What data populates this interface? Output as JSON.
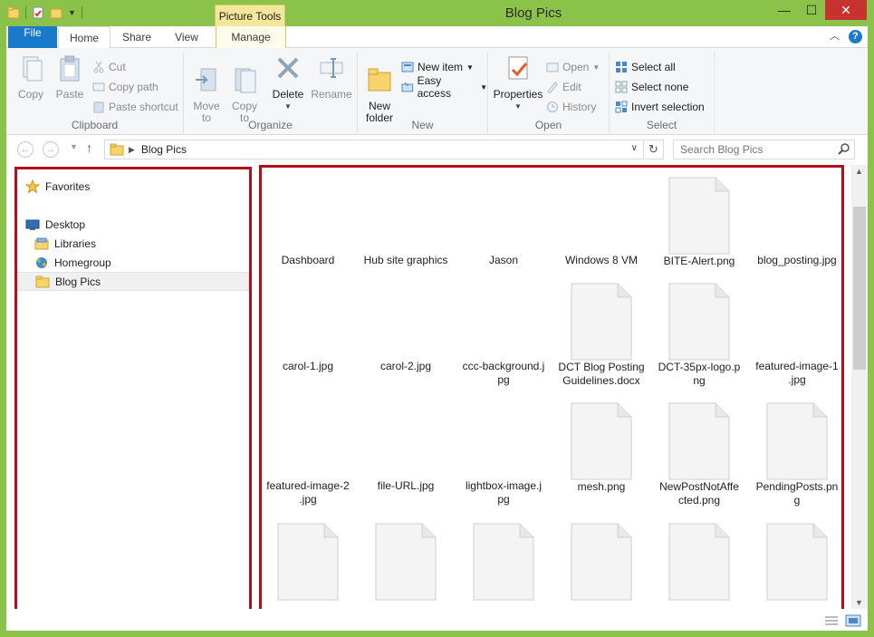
{
  "window": {
    "title": "Blog Pics",
    "context_tab_group": "Picture Tools",
    "controls": {
      "minimize": "—",
      "maximize": "☐",
      "close": "✕"
    }
  },
  "tabs": {
    "file": "File",
    "home": "Home",
    "share": "Share",
    "view": "View",
    "manage": "Manage",
    "help": "?"
  },
  "ribbon": {
    "clipboard": {
      "label": "Clipboard",
      "copy": "Copy",
      "paste": "Paste",
      "cut": "Cut",
      "copy_path": "Copy path",
      "paste_shortcut": "Paste shortcut"
    },
    "organize": {
      "label": "Organize",
      "move_to": "Move\nto",
      "copy_to": "Copy\nto",
      "delete": "Delete",
      "rename": "Rename"
    },
    "new": {
      "label": "New",
      "new_folder": "New\nfolder",
      "new_item": "New item",
      "easy_access": "Easy access"
    },
    "open": {
      "label": "Open",
      "properties": "Properties",
      "open": "Open",
      "edit": "Edit",
      "history": "History"
    },
    "select": {
      "label": "Select",
      "select_all": "Select all",
      "select_none": "Select none",
      "invert_selection": "Invert selection"
    }
  },
  "address": {
    "path": "Blog Pics",
    "search_placeholder": "Search Blog Pics"
  },
  "nav": {
    "favorites": "Favorites",
    "desktop": "Desktop",
    "libraries": "Libraries",
    "homegroup": "Homegroup",
    "blog_pics": "Blog Pics"
  },
  "files": {
    "row1": [
      "Dashboard",
      "Hub site graphics",
      "Jason",
      "Windows 8 VM",
      "BITE-Alert.png",
      "blog_posting.jpg"
    ],
    "row2": [
      [
        "carol-1.jpg",
        ""
      ],
      [
        "carol-2.jpg",
        ""
      ],
      [
        "ccc-background.j",
        "pg"
      ],
      [
        "DCT Blog Posting",
        "Guidelines.docx"
      ],
      [
        "DCT-35px-logo.p",
        "ng"
      ],
      [
        "featured-image-1",
        ".jpg"
      ]
    ],
    "row3": [
      [
        "featured-image-2",
        ".jpg"
      ],
      [
        "file-URL.jpg",
        ""
      ],
      [
        "lightbox-image.j",
        "pg"
      ],
      [
        "mesh.png",
        ""
      ],
      [
        "NewPostNotAffe",
        "cted.png"
      ],
      [
        "PendingPosts.pn",
        "g"
      ]
    ]
  },
  "colors": {
    "accent": "#1979ca",
    "title_bar": "#8bc34a",
    "highlight_border": "#b30f1b",
    "context_tab": "#f2e79b"
  }
}
